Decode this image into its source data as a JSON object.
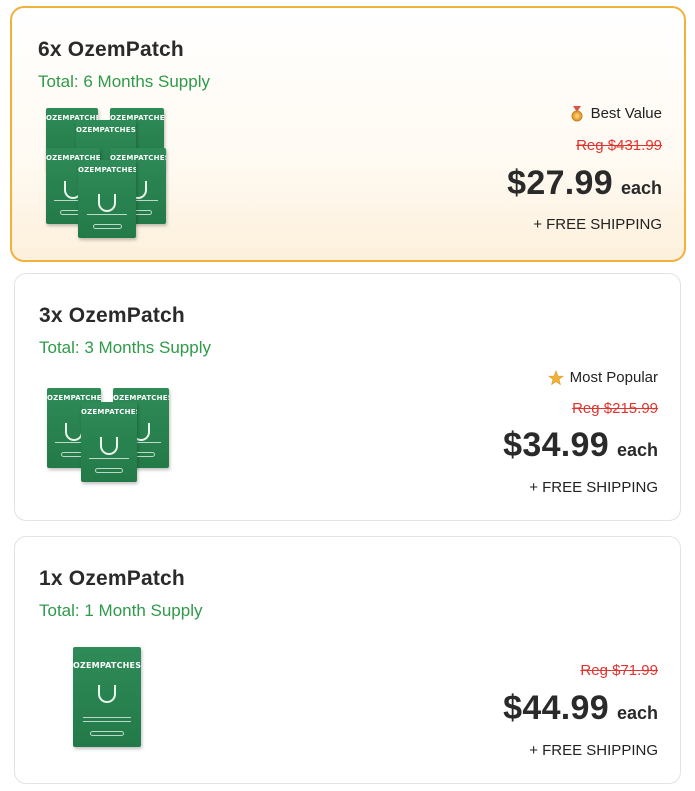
{
  "offers": [
    {
      "title": "6x OzemPatch",
      "supply": "Total: 6 Months Supply",
      "badge": "Best Value",
      "badge_icon": "medal-icon",
      "reg_price": "Reg $431.99",
      "price": "$27.99",
      "unit": "each",
      "shipping": "+ FREE SHIPPING",
      "box_label": "OZEMPATCHES",
      "selected": true
    },
    {
      "title": "3x OzemPatch",
      "supply": "Total: 3 Months Supply",
      "badge": "Most Popular",
      "badge_icon": "star-icon",
      "reg_price": "Reg $215.99",
      "price": "$34.99",
      "unit": "each",
      "shipping": "+ FREE SHIPPING",
      "box_label": "OZEMPATCHES",
      "selected": false
    },
    {
      "title": "1x OzemPatch",
      "supply": "Total: 1 Month Supply",
      "reg_price": "Reg $71.99",
      "price": "$44.99",
      "unit": "each",
      "shipping": "+ FREE SHIPPING",
      "box_label": "OZEMPATCHES",
      "selected": false
    }
  ],
  "colors": {
    "selected_border": "#f0b23a",
    "supply_green": "#2f9a4a",
    "reg_red": "#e0342f",
    "box_green": "#2e8b57"
  }
}
